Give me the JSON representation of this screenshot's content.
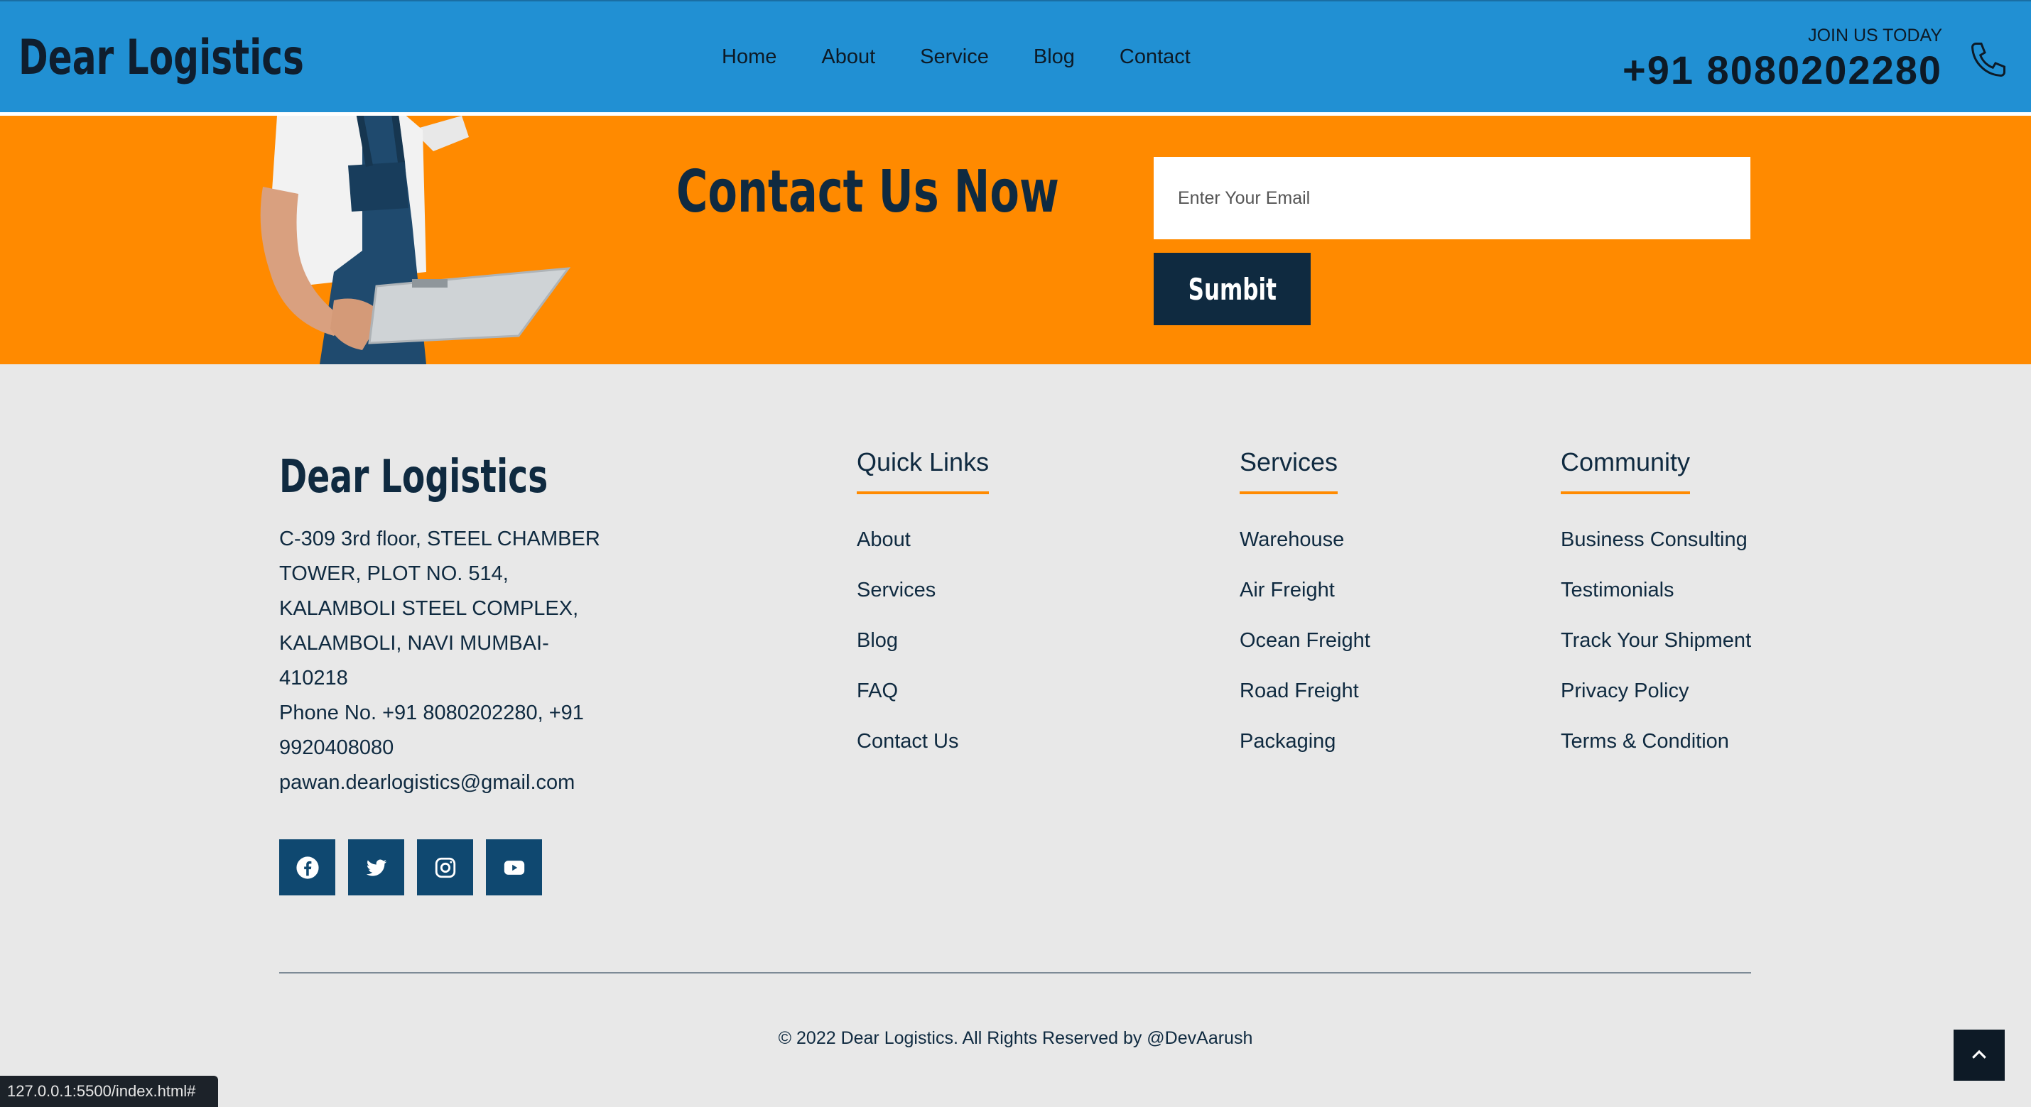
{
  "header": {
    "brand": "Dear Logistics",
    "nav": [
      "Home",
      "About",
      "Service",
      "Blog",
      "Contact"
    ],
    "join_label": "JOIN US TODAY",
    "phone": "+91 8080202280"
  },
  "contact": {
    "title": "Contact Us Now",
    "email_placeholder": "Enter Your Email",
    "submit_label": "Sumbit"
  },
  "footer": {
    "brand": "Dear Logistics",
    "address_lines": [
      "C-309 3rd floor, STEEL CHAMBER",
      "TOWER, PLOT NO. 514,",
      "KALAMBOLI STEEL COMPLEX,",
      "KALAMBOLI, NAVI MUMBAI-",
      "410218",
      "Phone No. +91 8080202280, +91",
      "9920408080",
      "pawan.dearlogistics@gmail.com"
    ],
    "socials": [
      "facebook-icon",
      "twitter-icon",
      "instagram-icon",
      "youtube-icon"
    ],
    "quick_links": {
      "title": "Quick Links",
      "items": [
        "About",
        "Services",
        "Blog",
        "FAQ",
        "Contact Us"
      ]
    },
    "services": {
      "title": "Services",
      "items": [
        "Warehouse",
        "Air Freight",
        "Ocean Freight",
        "Road Freight",
        "Packaging"
      ]
    },
    "community": {
      "title": "Community",
      "items": [
        "Business Consulting",
        "Testimonials",
        "Track Your Shipment",
        "Privacy Policy",
        "Terms & Condition"
      ]
    },
    "copyright": "© 2022 Dear Logistics. All Rights Reserved by @DevAarush"
  },
  "status_bar": {
    "url": "127.0.0.1:5500/index.html#"
  },
  "colors": {
    "header_bg": "#2190d3",
    "accent": "#ff8a00",
    "dark_navy": "#0f2a40",
    "social_bg": "#0f4870",
    "footer_bg": "#e8e8e8"
  }
}
